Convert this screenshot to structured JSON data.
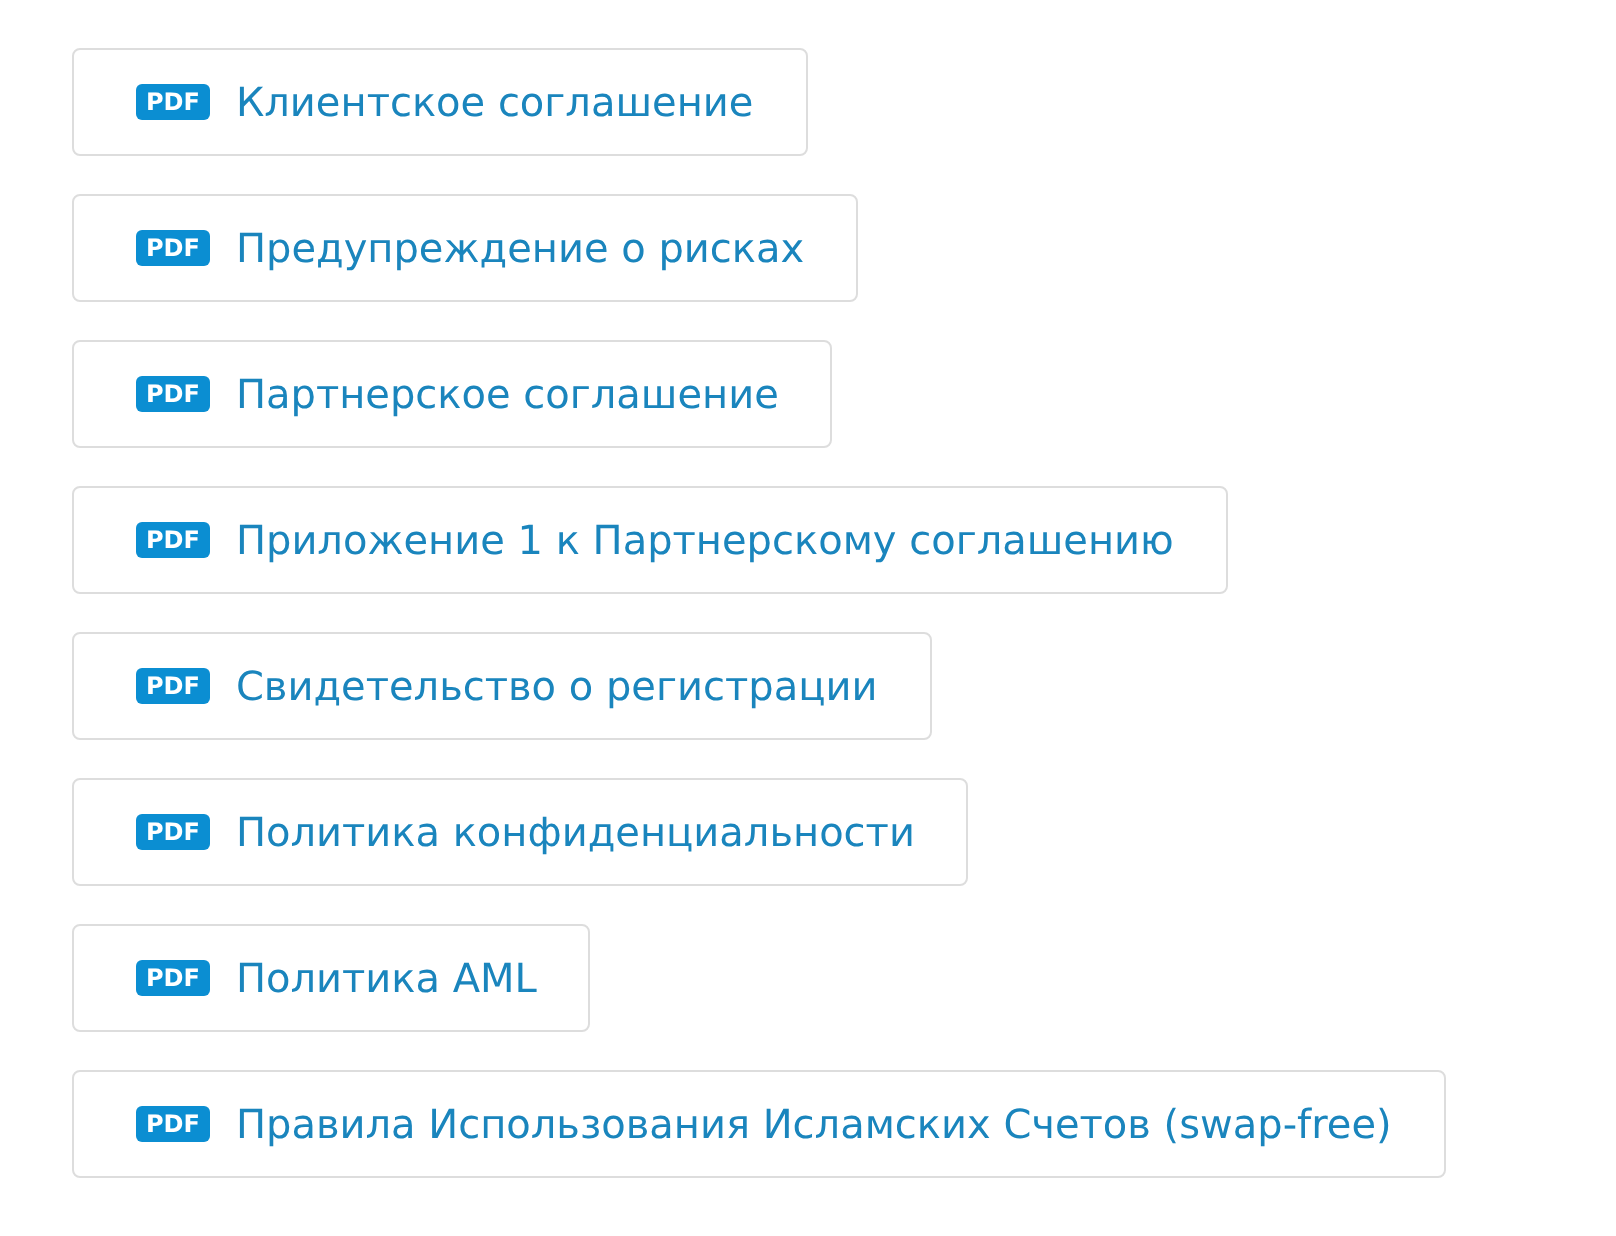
{
  "documents": [
    {
      "badge": "PDF",
      "title": "Клиентское соглашение"
    },
    {
      "badge": "PDF",
      "title": "Предупреждение о рисках"
    },
    {
      "badge": "PDF",
      "title": "Партнерское соглашение"
    },
    {
      "badge": "PDF",
      "title": "Приложение 1 к Партнерскому соглашению"
    },
    {
      "badge": "PDF",
      "title": "Свидетельство о регистрации"
    },
    {
      "badge": "PDF",
      "title": "Политика конфиденциальности"
    },
    {
      "badge": "PDF",
      "title": "Политика AML"
    },
    {
      "badge": "PDF",
      "title": "Правила Использования Исламских Счетов (swap-free)"
    }
  ]
}
